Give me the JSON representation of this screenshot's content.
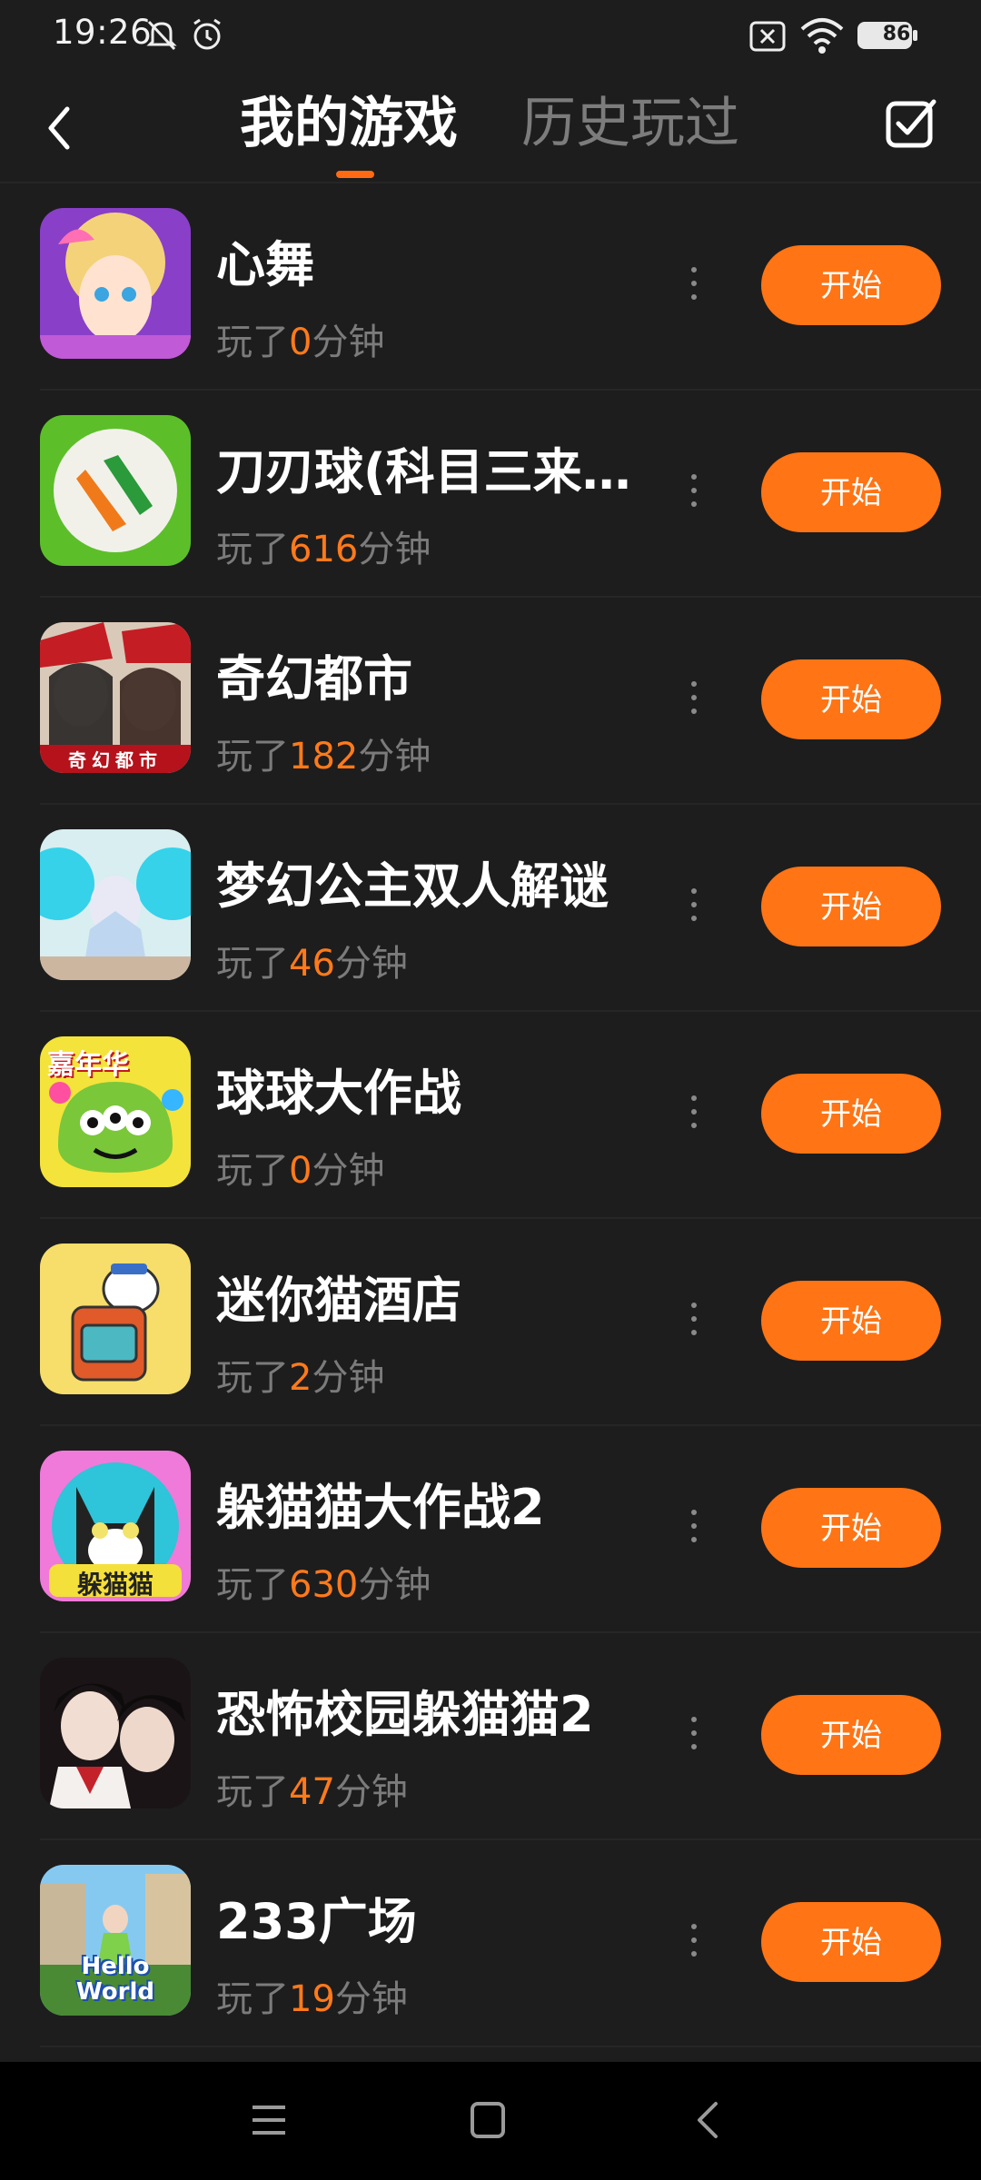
{
  "status_bar": {
    "time": "19:26",
    "battery": "86"
  },
  "header": {
    "tab_active": "我的游戏",
    "tab_inactive": "历史玩过"
  },
  "games": [
    {
      "name": "心舞",
      "prefix": "玩了",
      "minutes": "0",
      "suffix": "分钟",
      "button": "开始",
      "icon": "heart-dance-icon"
    },
    {
      "name": "刀刃球(科目三来…",
      "prefix": "玩了",
      "minutes": "616",
      "suffix": "分钟",
      "button": "开始",
      "icon": "blade-ball-icon"
    },
    {
      "name": "奇幻都市",
      "prefix": "玩了",
      "minutes": "182",
      "suffix": "分钟",
      "button": "开始",
      "icon": "fantasy-city-icon",
      "icon_text": "奇幻都市"
    },
    {
      "name": "梦幻公主双人解谜",
      "prefix": "玩了",
      "minutes": "46",
      "suffix": "分钟",
      "button": "开始",
      "icon": "dream-princess-icon"
    },
    {
      "name": "球球大作战",
      "prefix": "玩了",
      "minutes": "0",
      "suffix": "分钟",
      "button": "开始",
      "icon": "ball-battle-icon",
      "icon_text": "嘉年华"
    },
    {
      "name": "迷你猫酒店",
      "prefix": "玩了",
      "minutes": "2",
      "suffix": "分钟",
      "button": "开始",
      "icon": "mini-cat-hotel-icon"
    },
    {
      "name": "躲猫猫大作战2",
      "prefix": "玩了",
      "minutes": "630",
      "suffix": "分钟",
      "button": "开始",
      "icon": "hide-cat-icon",
      "icon_text": "躲猫猫"
    },
    {
      "name": "恐怖校园躲猫猫2",
      "prefix": "玩了",
      "minutes": "47",
      "suffix": "分钟",
      "button": "开始",
      "icon": "horror-school-icon"
    },
    {
      "name": "233广场",
      "prefix": "玩了",
      "minutes": "19",
      "suffix": "分钟",
      "button": "开始",
      "icon": "hello-world-icon",
      "icon_text": "Hello World"
    }
  ],
  "colors": {
    "accent": "#ff7414",
    "background": "#1d1d1d",
    "muted_text": "#7b7b7b"
  }
}
